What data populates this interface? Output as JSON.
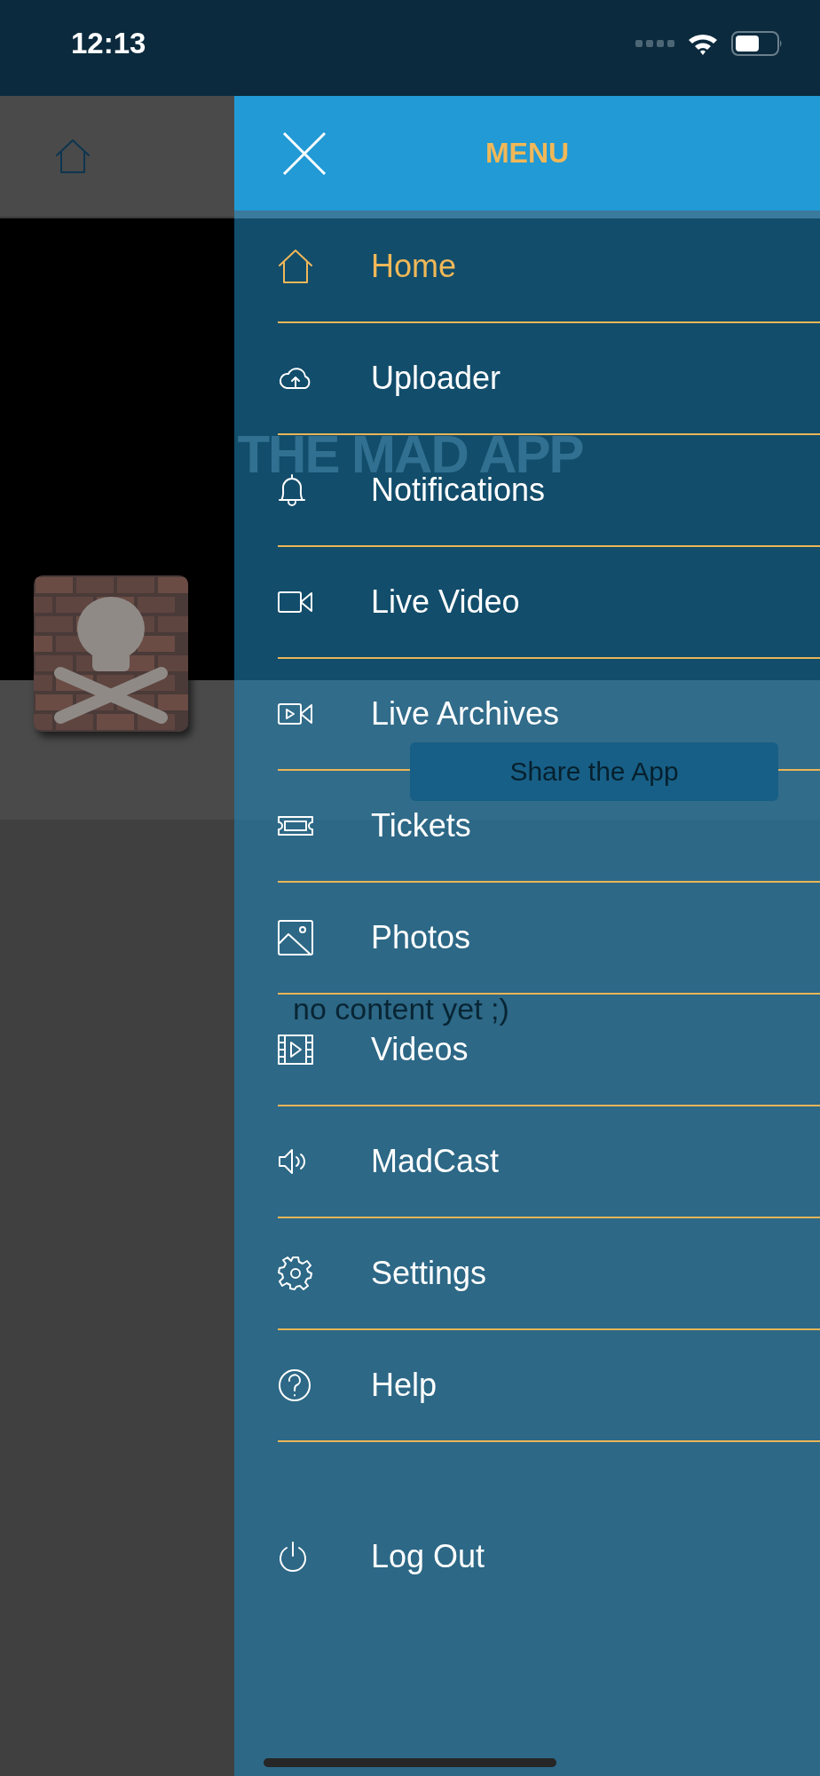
{
  "status_bar": {
    "time": "12:13"
  },
  "page": {
    "logo": "THE MAD APP",
    "share_button": "Share the App",
    "empty_message": "no content yet ;)"
  },
  "drawer": {
    "title": "MENU",
    "items": [
      {
        "label": "Home",
        "selected": true
      },
      {
        "label": "Uploader",
        "selected": false
      },
      {
        "label": "Notifications",
        "selected": false
      },
      {
        "label": "Live Video",
        "selected": false
      },
      {
        "label": "Live Archives",
        "selected": false
      },
      {
        "label": "Tickets",
        "selected": false
      },
      {
        "label": "Photos",
        "selected": false
      },
      {
        "label": "Videos",
        "selected": false
      },
      {
        "label": "MadCast",
        "selected": false
      },
      {
        "label": "Settings",
        "selected": false
      },
      {
        "label": "Help",
        "selected": false
      }
    ],
    "logout": {
      "label": "Log Out"
    }
  }
}
